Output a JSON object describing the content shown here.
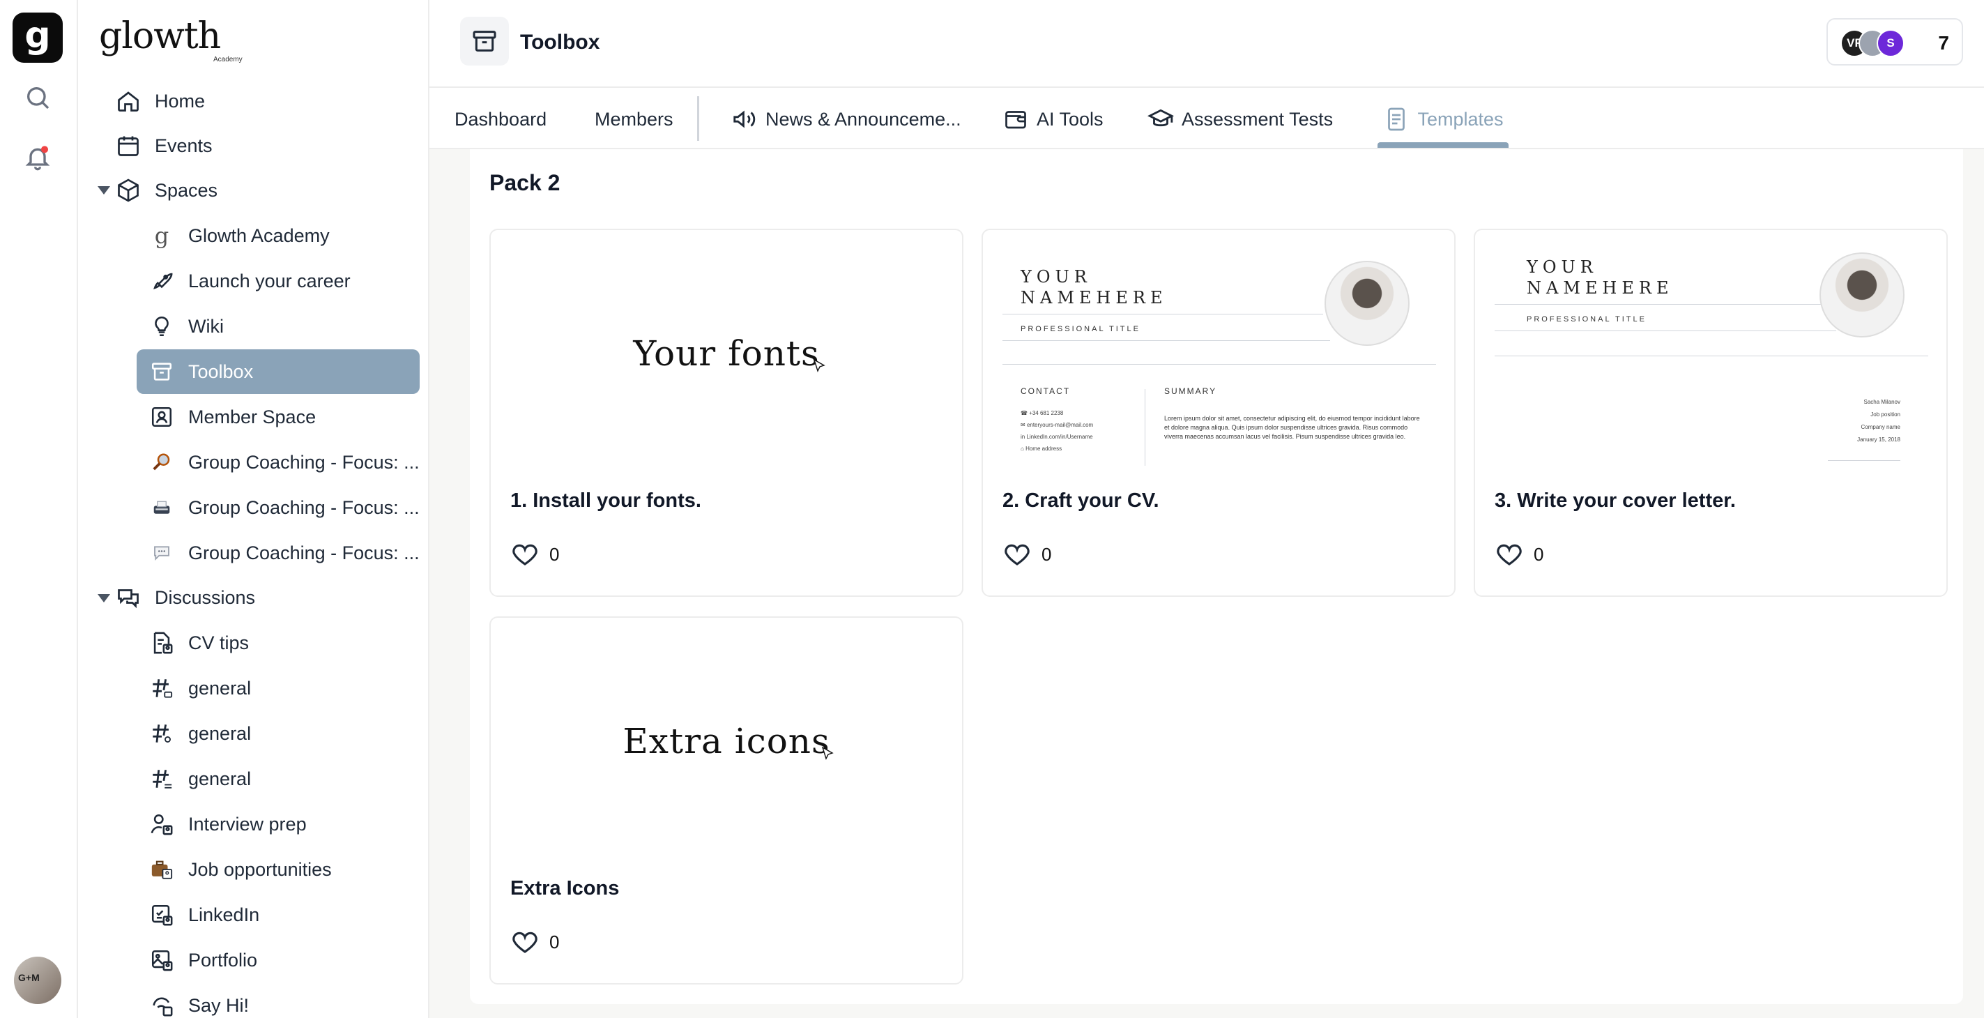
{
  "rail": {
    "logo_letter": "g",
    "avatar_initials": "G+M"
  },
  "brand": {
    "name": "glowth",
    "sub": "Academy"
  },
  "sidebar": {
    "top_items": [
      {
        "label": "Home",
        "icon": "home-icon"
      },
      {
        "label": "Events",
        "icon": "calendar-icon"
      }
    ],
    "spaces_label": "Spaces",
    "spaces": [
      {
        "label": "Glowth Academy",
        "icon": "glowth-logo-icon"
      },
      {
        "label": "Launch your career",
        "icon": "rocket-icon"
      },
      {
        "label": "Wiki",
        "icon": "lightbulb-icon"
      },
      {
        "label": "Toolbox",
        "icon": "archive-box-icon",
        "active": true
      },
      {
        "label": "Member Space",
        "icon": "member-card-icon"
      },
      {
        "label": "Group Coaching - Focus: ...",
        "icon": "magnifier-emoji-icon"
      },
      {
        "label": "Group Coaching - Focus: ...",
        "icon": "typewriter-emoji-icon"
      },
      {
        "label": "Group Coaching - Focus: ...",
        "icon": "speech-bubble-emoji-icon"
      }
    ],
    "discussions_label": "Discussions",
    "discussions": [
      {
        "label": "CV tips",
        "icon": "document-user-icon"
      },
      {
        "label": "general",
        "icon": "hashtag-chat-icon"
      },
      {
        "label": "general",
        "icon": "hashtag-search-icon"
      },
      {
        "label": "general",
        "icon": "hashtag-list-icon"
      },
      {
        "label": "Interview prep",
        "icon": "person-badge-icon"
      },
      {
        "label": "Job opportunities",
        "icon": "briefcase-icon"
      },
      {
        "label": "LinkedIn",
        "icon": "checklist-icon"
      },
      {
        "label": "Portfolio",
        "icon": "image-frame-icon"
      },
      {
        "label": "Say Hi!",
        "icon": "wave-icon"
      }
    ]
  },
  "header": {
    "title": "Toolbox",
    "icon": "archive-box-icon",
    "avatars": [
      {
        "initials": "VF",
        "color": "#1f1f1f"
      },
      {
        "initials": "",
        "color": "#9ca3af"
      },
      {
        "initials": "S",
        "color": "#6d28d9"
      }
    ],
    "member_count": "7"
  },
  "tabs": [
    {
      "label": "Dashboard",
      "icon": ""
    },
    {
      "label": "Members",
      "icon": ""
    },
    {
      "label": "News & Announceme...",
      "icon": "megaphone-icon"
    },
    {
      "label": "AI Tools",
      "icon": "wallet-icon"
    },
    {
      "label": "Assessment Tests",
      "icon": "graduation-cap-icon"
    },
    {
      "label": "Templates",
      "icon": "document-icon",
      "active": true
    }
  ],
  "main": {
    "pack_title": "Pack 2",
    "cards": [
      {
        "title": "1. Install your fonts.",
        "likes": "0",
        "preview_text": "Your fonts"
      },
      {
        "title": "2. Craft your CV.",
        "likes": "0"
      },
      {
        "title": "3. Write your cover letter.",
        "likes": "0"
      },
      {
        "title": "Extra Icons",
        "likes": "0",
        "preview_text": "Extra icons"
      }
    ],
    "cv": {
      "name_line1": "YOUR",
      "name_line2": "NAMEHERE",
      "subtitle": "PROFESSIONAL TITLE",
      "contact_head": "CONTACT",
      "summary_head": "SUMMARY",
      "contact_lines": [
        "+34 681 2238",
        "enteryours-mail@mail.com",
        "LinkedIn.com/in/Username",
        "Home address"
      ],
      "summary_text": "Lorem ipsum dolor sit amet, consectetur adipiscing elit, do eiusmod tempor incididunt labore et dolore magna aliqua. Quis ipsum dolor suspendisse ultrices gravida. Risus commodo viverra maecenas accumsan lacus vel facilisis. Pisum suspendisse ultrices gravida leo."
    },
    "cover": {
      "name_line1": "YOUR",
      "name_line2": "NAMEHERE",
      "subtitle": "PROFESSIONAL TITLE",
      "recipient_lines": [
        "Sacha Milanov",
        "Job position",
        "Company name",
        "January 15, 2018"
      ]
    }
  }
}
